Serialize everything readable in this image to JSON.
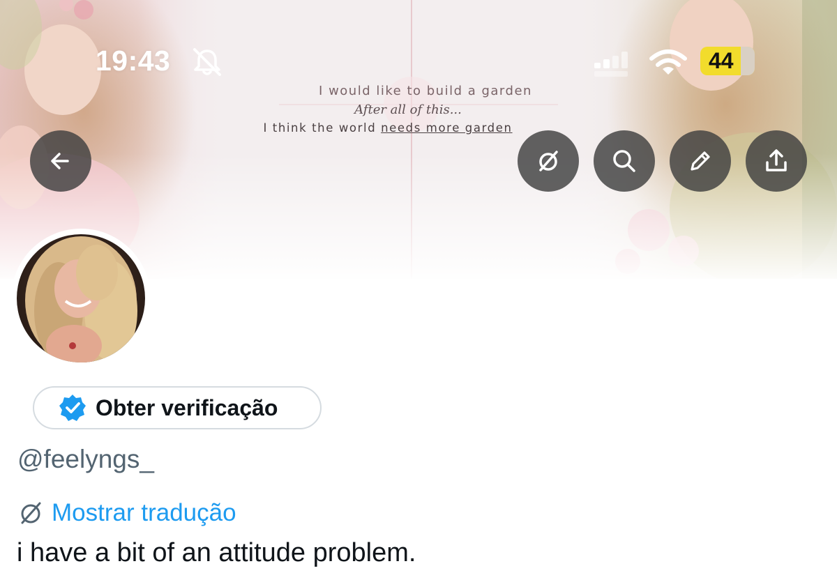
{
  "status_bar": {
    "time": "19:43",
    "battery_level": "44",
    "icons": [
      "bell-slash-icon",
      "cellular-signal-icon",
      "wifi-icon",
      "battery-icon"
    ]
  },
  "banner": {
    "lines": [
      "I would like to build a garden",
      "After all of this...",
      "I think the world "
    ],
    "underlined_text": "needs more garden"
  },
  "header_buttons": {
    "back": "arrow-left-icon",
    "grok": "grok-slash-icon",
    "search": "search-icon",
    "edit": "pencil-icon",
    "share": "share-upload-icon"
  },
  "profile": {
    "verify_label": "Obter verificação",
    "handle": "@feelyngs_",
    "translate_label": "Mostrar tradução",
    "bio": "i have a bit of an attitude problem."
  },
  "colors": {
    "accent": "#1d9bf0",
    "text_primary": "#0f1419",
    "text_secondary": "#536471",
    "battery": "#f2dc2c",
    "button_bg": "#404040"
  }
}
